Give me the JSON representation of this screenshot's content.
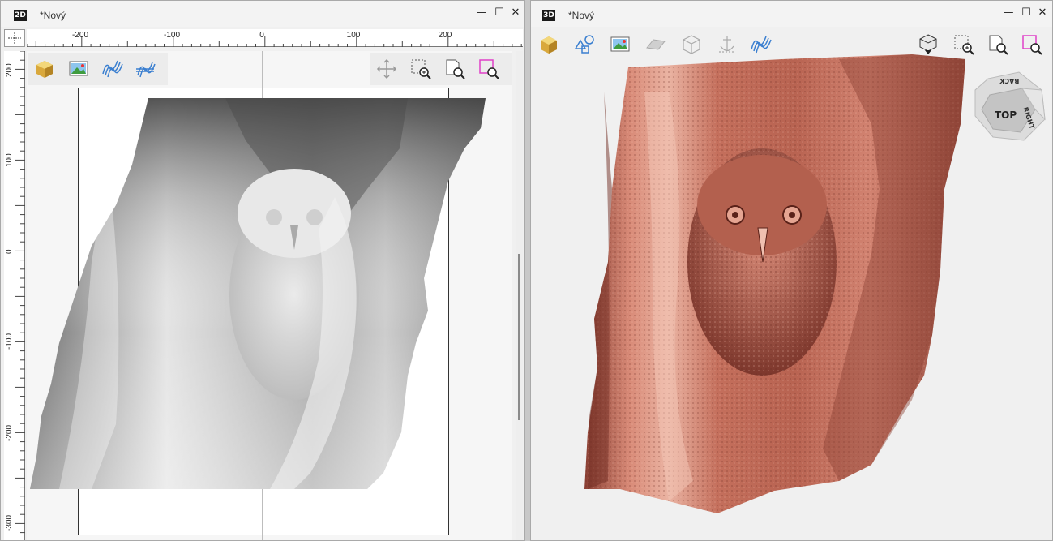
{
  "panes": {
    "left": {
      "badge": "2D",
      "title": "*Nový",
      "window_buttons": {
        "minimize": "—",
        "maximize": "☐",
        "close": "✕"
      },
      "ruler_x_labels": [
        "-200",
        "-100",
        "0",
        "100",
        "200"
      ],
      "ruler_y_labels": [
        "200",
        "100",
        "0",
        "-100",
        "-200",
        "-300"
      ],
      "toolbar_left": [
        "cube-icon",
        "image-icon",
        "relief-wave-icon",
        "relief-filter-icon"
      ],
      "toolbar_right": [
        "pan-icon",
        "zoom-window-icon",
        "zoom-extents-icon",
        "zoom-selection-icon"
      ]
    },
    "right": {
      "badge": "3D",
      "title": "*Nový",
      "window_buttons": {
        "minimize": "—",
        "maximize": "☐",
        "close": "✕"
      },
      "toolbar_left": [
        "cube-icon",
        "shapes-icon",
        "image-icon",
        "plane-icon",
        "wireframe-box-icon",
        "anchor-icon",
        "relief-wave-icon"
      ],
      "toolbar_right": [
        "view-cube-icon",
        "zoom-window-icon",
        "zoom-extents-icon",
        "zoom-selection-icon"
      ],
      "viewcube": {
        "top_label": "TOP",
        "right_label": "RIGHT",
        "back_label": "BACK"
      }
    }
  },
  "colors": {
    "relief_model": "#c97866",
    "accent_magenta": "#e040c8",
    "tool_blue": "#3a7fd0"
  }
}
